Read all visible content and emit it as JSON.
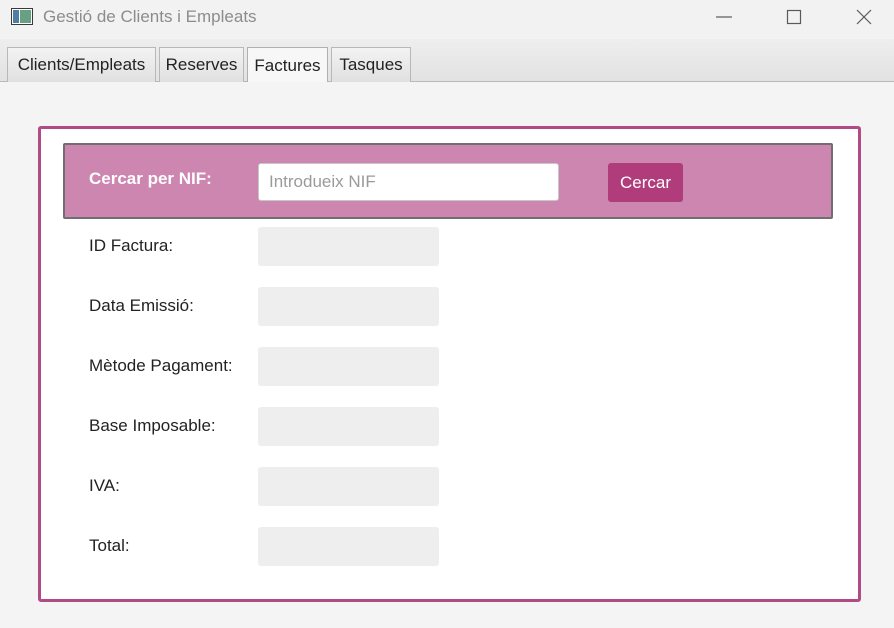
{
  "window": {
    "title": "Gestió de Clients i Empleats",
    "icon": "app-window-icon",
    "controls": [
      "minimize-icon",
      "maximize-icon",
      "close-icon"
    ]
  },
  "tabs": [
    {
      "label": "Clients/Empleats",
      "selected": false
    },
    {
      "label": "Reserves",
      "selected": false
    },
    {
      "label": "Factures",
      "selected": true
    },
    {
      "label": "Tasques",
      "selected": false
    }
  ],
  "search": {
    "label": "Cercar per NIF:",
    "value": "",
    "placeholder": "Introdueix NIF",
    "button_label": "Cercar"
  },
  "fields": [
    {
      "label": "ID Factura:",
      "value": ""
    },
    {
      "label": "Data Emissió:",
      "value": ""
    },
    {
      "label": "Mètode Pagament:",
      "value": ""
    },
    {
      "label": "Base Imposable:",
      "value": ""
    },
    {
      "label": "IVA:",
      "value": ""
    },
    {
      "label": "Total:",
      "value": ""
    }
  ],
  "colors": {
    "accent_border": "#b04b85",
    "search_bar_background": "#cc86b0",
    "search_button": "#b13c7c"
  }
}
